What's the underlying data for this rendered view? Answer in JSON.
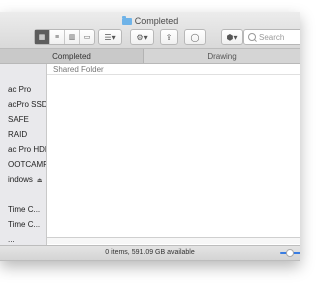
{
  "window": {
    "title": "Completed"
  },
  "toolbar": {
    "view_icons": [
      "grid-view-icon",
      "list-view-icon",
      "column-view-icon",
      "coverflow-view-icon"
    ],
    "arrange_label": "☰▾",
    "action_label": "⚙▾",
    "share_label": "⇪",
    "tag_label": "◯",
    "dropbox_label": "⬢▾",
    "search_placeholder": "Search"
  },
  "tabs": [
    {
      "label": "Completed"
    },
    {
      "label": "Drawing"
    }
  ],
  "sidebar": {
    "items": [
      {
        "label": "ac Pro",
        "eject": false
      },
      {
        "label": "acPro SSD",
        "eject": false
      },
      {
        "label": "SAFE",
        "eject": false
      },
      {
        "label": "RAID",
        "eject": false
      },
      {
        "label": "ac Pro HDD",
        "eject": false
      },
      {
        "label": "OOTCAMP",
        "eject": false
      },
      {
        "label": "indows",
        "eject": true
      },
      {
        "label": "Time C...",
        "eject": false
      },
      {
        "label": "Time C...",
        "eject": false
      },
      {
        "label": "...",
        "eject": false
      }
    ]
  },
  "main": {
    "column_header": "Shared Folder"
  },
  "status": {
    "text": "0 items, 591.09 GB available"
  }
}
